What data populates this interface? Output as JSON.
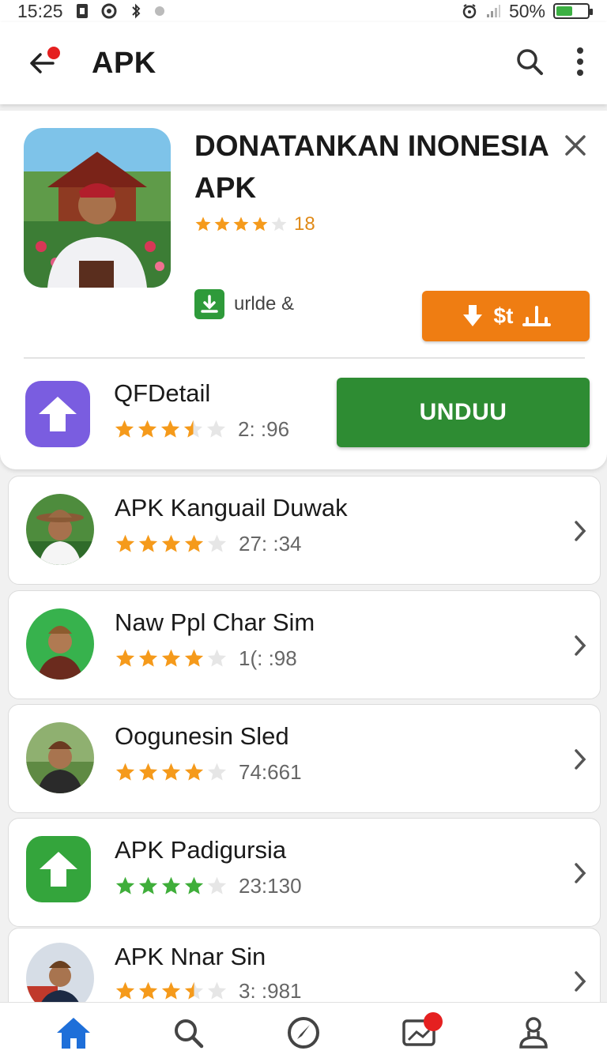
{
  "status_bar": {
    "time": "15:25",
    "battery_percent": "50%",
    "battery_level": 0.5,
    "battery_color": "#3cb043"
  },
  "app_bar": {
    "title": "APK"
  },
  "featured": {
    "title": "DONATANKAN INONESIA APK",
    "rating_count": "18",
    "rating_stars": 4,
    "download_label": "urlde &",
    "orange_button_label": "$t",
    "secondary": {
      "name": "QFDetail",
      "rating_count": "2: :96",
      "rating_stars": 3.5,
      "button_label": "UNDUU"
    }
  },
  "list": [
    {
      "name": "APK Kanguail Duwak",
      "count": "27: :34",
      "stars": 4,
      "thumb": "avatar-hat-man",
      "bg": "#3d8c3a"
    },
    {
      "name": "Naw Ppl Char Sim",
      "count": "1(: :98",
      "stars": 4,
      "thumb": "avatar-green-bg",
      "bg": "#37b24d"
    },
    {
      "name": "Oogunesin Sled",
      "count": "74:661",
      "stars": 4,
      "thumb": "avatar-garden",
      "bg": "#7a9a5a"
    },
    {
      "name": "APK Padigursia",
      "count": "23:130",
      "stars": 4,
      "thumb": "app-icon-green",
      "bg": "#34a53c"
    },
    {
      "name": "APK Nnar Sin",
      "count": "3: :981",
      "stars": 3.5,
      "thumb": "avatar-suit",
      "bg": "#5c8ac9"
    }
  ],
  "colors": {
    "orange": "#ef7d12",
    "green_button": "#2e8c33",
    "purple_icon": "#7a5de0",
    "star": "#f59a1b",
    "star_green": "#3fae3a",
    "nav_active": "#1e6fd9"
  },
  "nav": [
    "home-icon",
    "search-icon",
    "compass-icon",
    "image-icon",
    "profile-icon"
  ]
}
